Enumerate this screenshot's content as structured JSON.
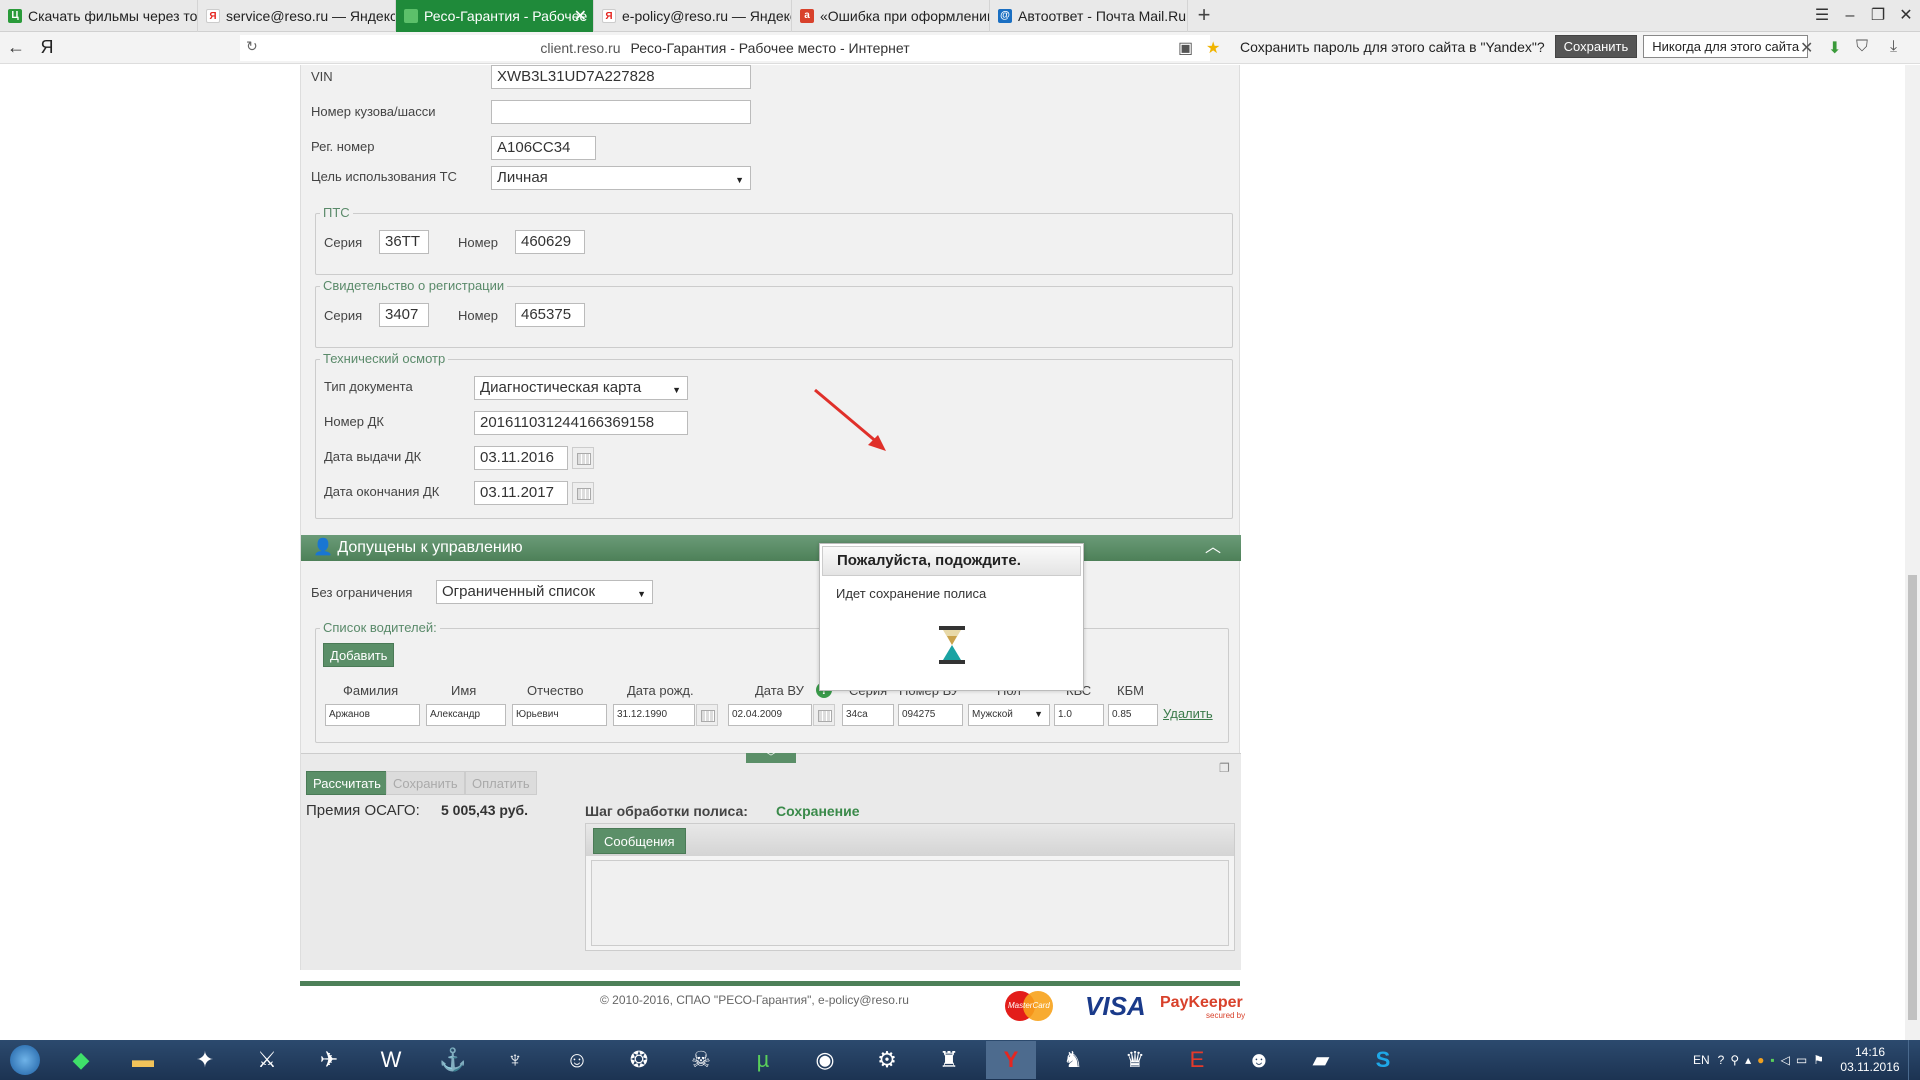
{
  "browser": {
    "tabs": [
      {
        "label": "Скачать фильмы через тор",
        "fav": "utorrent-icon",
        "color": "#2a9b3a",
        "active": false
      },
      {
        "label": "service@reso.ru — Яндекс",
        "fav": "yandex-icon",
        "color": "#e52620",
        "active": false
      },
      {
        "label": "Ресо-Гарантия - Рабочее",
        "fav": "reso-icon",
        "color": "#1f8a3a",
        "active": true
      },
      {
        "label": "e-policy@reso.ru — Яндекс",
        "fav": "yandex-icon",
        "color": "#e52620",
        "active": false
      },
      {
        "label": "«Ошибка при оформлении",
        "fav": "a-icon",
        "color": "#d8412b",
        "active": false
      },
      {
        "label": "Автоответ - Почта Mail.Ru",
        "fav": "mail-icon",
        "color": "#1a6fc2",
        "active": false
      }
    ],
    "new_tab": "+",
    "yandex_logo": "Я",
    "domain": "client.reso.ru",
    "page_title": "Ресо-Гарантия - Рабочее место - Интернет",
    "save_password_prompt": "Сохранить пароль для этого сайта в \"Yandex\"?",
    "save_btn": "Сохранить",
    "never_btn": "Никогда для этого сайта"
  },
  "vehicle": {
    "vin_label": "VIN",
    "vin": "XWB3L31UD7A227828",
    "body_label": "Номер кузова/шасси",
    "body": "",
    "reg_label": "Рег. номер",
    "reg": "А106СС34",
    "purpose_label": "Цель использования ТС",
    "purpose": "Личная"
  },
  "pts": {
    "legend": "ПТС",
    "series_label": "Серия",
    "series": "36ТТ",
    "number_label": "Номер",
    "number": "460629"
  },
  "registration": {
    "legend": "Свидетельство о регистрации",
    "series_label": "Серия",
    "series": "3407",
    "number_label": "Номер",
    "number": "465375"
  },
  "inspection": {
    "legend": "Технический осмотр",
    "doc_type_label": "Тип документа",
    "doc_type": "Диагностическая карта",
    "dk_label": "Номер ДК",
    "dk": "201611031244166369158",
    "issue_label": "Дата выдачи ДК",
    "issue": "03.11.2016",
    "end_label": "Дата окончания ДК",
    "end": "03.11.2017"
  },
  "drivers_section": {
    "title": "Допущены к управлению",
    "unlimited_label": "Без ограничения",
    "unlimited": "Ограниченный список",
    "list_legend": "Список водителей:",
    "add_btn": "Добавить",
    "headers": [
      "Фамилия",
      "Имя",
      "Отчество",
      "Дата рожд.",
      "Дата ВУ",
      "Серия",
      "Номер ВУ",
      "Пол",
      "КВС",
      "КБМ"
    ],
    "row": {
      "surname": "Аржанов",
      "name": "Александр",
      "patronymic": "Юрьевич",
      "birth": "31.12.1990",
      "license_date": "02.04.2009",
      "series": "34са",
      "number": "094275",
      "sex": "Мужской",
      "kvs": "1.0",
      "kbm": "0.85",
      "delete": "Удалить"
    }
  },
  "bottom": {
    "calc_btn": "Рассчитать",
    "save_btn": "Сохранить",
    "pay_btn": "Оплатить",
    "premium_label": "Премия ОСАГО:",
    "premium": "5 005,43 руб.",
    "step_label": "Шаг обработки полиса:",
    "step": "Сохранение",
    "messages_tab": "Сообщения"
  },
  "footer": {
    "copyright": "© 2010-2016, СПАО \"РЕСО-Гарантия\", e-policy@reso.ru",
    "mastercard": "MasterCard",
    "visa": "VISA",
    "paykeeper": "PayKeeper",
    "paykeeper_sub": "secured by"
  },
  "modal": {
    "title": "Пожалуйста, подождите.",
    "message": "Идет сохранение полиса"
  },
  "tray": {
    "lang": "EN",
    "time": "14:16",
    "date": "03.11.2016"
  },
  "colors": {
    "accent": "#1f8a3a",
    "form_green": "#5b8f68",
    "legend": "#5a8a6a"
  }
}
